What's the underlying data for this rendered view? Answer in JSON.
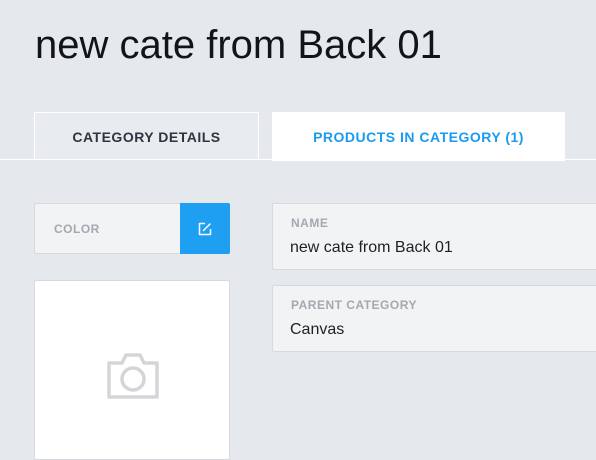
{
  "page": {
    "title": "new cate from Back 01"
  },
  "tabs": [
    {
      "label": "CATEGORY DETAILS",
      "active": false
    },
    {
      "label": "PRODUCTS IN CATEGORY (1)",
      "active": true
    }
  ],
  "form": {
    "color": {
      "label": "COLOR",
      "edit_icon": "edit-icon"
    },
    "image": {
      "icon": "camera-icon"
    },
    "name": {
      "label": "NAME",
      "value": "new cate from Back 01"
    },
    "parent_category": {
      "label": "PARENT CATEGORY",
      "value": "Canvas"
    }
  },
  "colors": {
    "accent": "#1e9ff2",
    "background": "#e5e8ec",
    "field_background": "#f1f3f5",
    "label": "#a3a9b0"
  }
}
